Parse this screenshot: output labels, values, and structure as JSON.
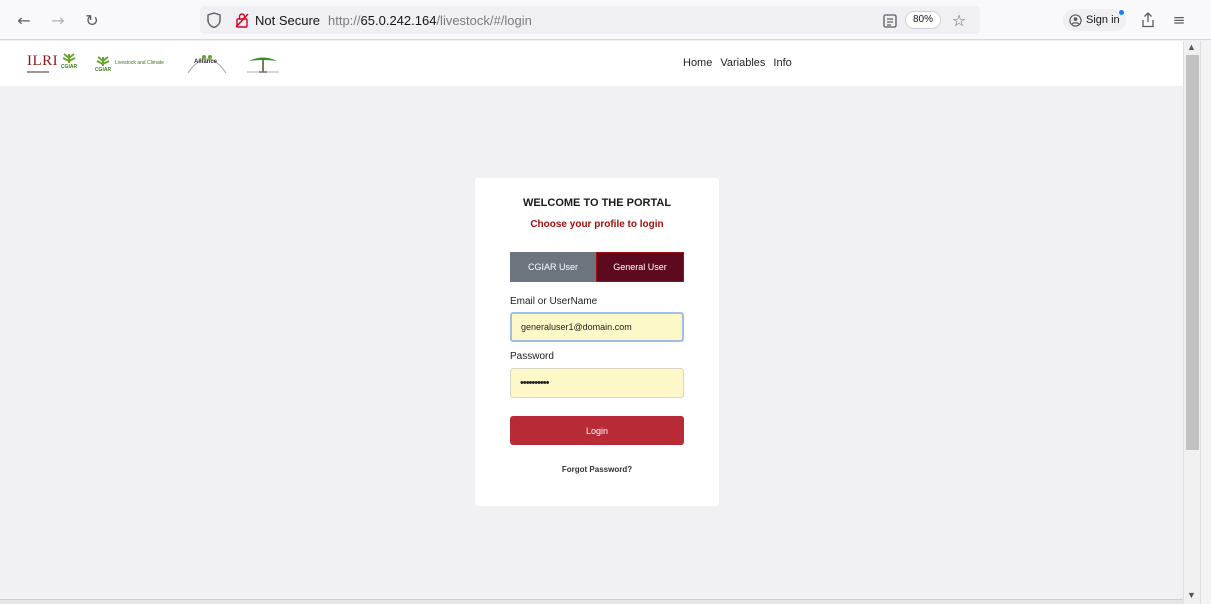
{
  "browser": {
    "not_secure_label": "Not Secure",
    "url_scheme": "http://",
    "url_host": "65.0.242.164",
    "url_path": "/livestock/#/login",
    "zoom": "80%",
    "signin_label": "Sign in"
  },
  "header": {
    "logos": {
      "ilri_text": "ILRI",
      "cgiar_label": "CGIAR",
      "cgiar2_label": "CGIAR",
      "livestock_climate_text": "Livestock and Climate",
      "alliance_text": "Alliance"
    },
    "nav": [
      "Home",
      "Variables",
      "Info"
    ]
  },
  "login": {
    "welcome": "WELCOME TO THE PORTAL",
    "choose": "Choose your profile to login",
    "profile_cgiar": "CGIAR User",
    "profile_general": "General User",
    "email_label": "Email or UserName",
    "email_value": "generaluser1@domain.com",
    "password_label": "Password",
    "password_value": "••••••••••",
    "login_button": "Login",
    "forgot": "Forgot Password?"
  },
  "colors": {
    "accent_red": "#b82a36",
    "selected_profile": "#5e0a1e",
    "autofill_bg": "#fdf8c8"
  }
}
